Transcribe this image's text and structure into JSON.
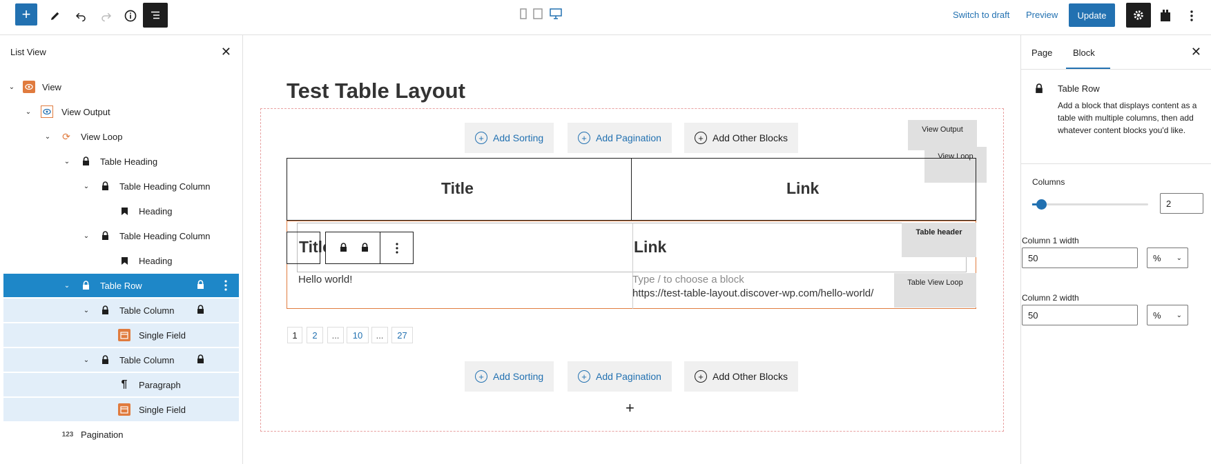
{
  "toolbar": {
    "add_icon": "plus-icon",
    "switch_to_draft": "Switch to draft",
    "preview": "Preview",
    "update": "Update",
    "accent": "#2271b1"
  },
  "list_view": {
    "title": "List View",
    "items": [
      {
        "label": "View",
        "icon": "view-icon"
      },
      {
        "label": "View Output",
        "icon": "view-output-icon"
      },
      {
        "label": "View Loop",
        "icon": "loop-icon"
      },
      {
        "label": "Table Heading",
        "icon": "lock-icon"
      },
      {
        "label": "Table Heading Column",
        "icon": "lock-icon"
      },
      {
        "label": "Heading",
        "icon": "bookmark-icon"
      },
      {
        "label": "Table Heading Column",
        "icon": "lock-icon"
      },
      {
        "label": "Heading",
        "icon": "bookmark-icon"
      },
      {
        "label": "Table Row",
        "icon": "lock-icon"
      },
      {
        "label": "Table Column",
        "icon": "lock-icon"
      },
      {
        "label": "Single Field",
        "icon": "calendar-icon"
      },
      {
        "label": "Table Column",
        "icon": "lock-icon"
      },
      {
        "label": "Paragraph",
        "icon": "pilcrow-icon"
      },
      {
        "label": "Single Field",
        "icon": "calendar-icon"
      },
      {
        "label": "Pagination",
        "icon": "numbers-icon"
      }
    ]
  },
  "canvas": {
    "page_title": "Test Table Layout",
    "add_sorting": "Add Sorting",
    "add_pagination": "Add Pagination",
    "add_other_blocks": "Add Other Blocks",
    "tag_view_output": "View Output",
    "tag_view_loop": "View Loop",
    "tag_table_header": "Table header",
    "tag_table_view_loop": "Table View Loop",
    "th_title": "Title",
    "th_link": "Link",
    "row_title": "Title",
    "row_link": "Link",
    "cell_hello": "Hello world!",
    "cell_placeholder": "Type / to choose a block",
    "cell_url": "https://test-table-layout.discover-wp.com/hello-world/",
    "pages": [
      "1",
      "2",
      "...",
      "10",
      "...",
      "27"
    ],
    "appender": "+"
  },
  "sidebar": {
    "tab_page": "Page",
    "tab_block": "Block",
    "block_name": "Table Row",
    "block_desc": "Add a block that displays content as a table with multiple columns, then add whatever content blocks you'd like.",
    "columns_label": "Columns",
    "columns_value": "2",
    "col1_label": "Column 1 width",
    "col1_value": "50",
    "col1_unit": "%",
    "col2_label": "Column 2 width",
    "col2_value": "50",
    "col2_unit": "%"
  }
}
